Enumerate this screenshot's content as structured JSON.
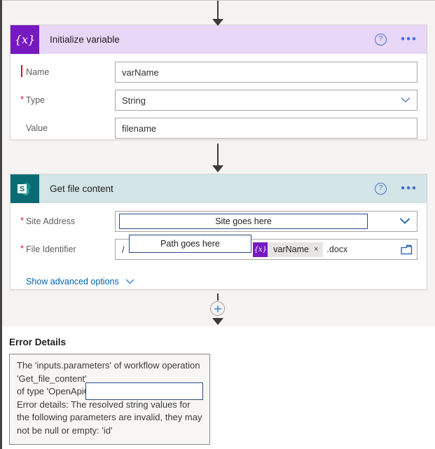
{
  "flow": {
    "cards": [
      {
        "id": "initialize-variable",
        "title": "Initialize variable",
        "icon": "variable-icon",
        "icon_glyph": "{x}",
        "header_color": "#e9d7f7",
        "icon_color": "#7719c1",
        "help_label": "?",
        "more_label": "•••",
        "fields": [
          {
            "label": "Name",
            "required": true,
            "value": "varName",
            "control": "text"
          },
          {
            "label": "Type",
            "required": true,
            "value": "String",
            "control": "dropdown"
          },
          {
            "label": "Value",
            "required": false,
            "value": "filename",
            "control": "text"
          }
        ]
      },
      {
        "id": "get-file-content",
        "title": "Get file content",
        "icon": "sharepoint-icon",
        "icon_glyph": "S",
        "header_color": "#d3e5e6",
        "icon_color": "#0a6c72",
        "help_label": "?",
        "more_label": "•••",
        "fields": [
          {
            "label": "Site Address",
            "required": true,
            "control": "dropdown",
            "annotation": "Site goes here"
          },
          {
            "label": "File Identifier",
            "required": true,
            "control": "token",
            "annotation": "Path goes here",
            "prefix_slash": "/",
            "mid_slash": "/",
            "token_glyph": "{x}",
            "token_label": "varName",
            "token_remove": "×",
            "suffix": ".docx",
            "picker_icon": "folder-icon"
          }
        ],
        "advanced_link": "Show advanced options"
      }
    ],
    "add_step_label": "+"
  },
  "error": {
    "title": "Error Details",
    "message": "The 'inputs.parameters' of workflow operation\n'Get_file_content'\nof type 'OpenApiConnection' is not valid.\nError details: The resolved string values for the following parameters are invalid, they may not be null or empty: 'id'"
  },
  "colors": {
    "canvas": "#f5f4f3",
    "variable_purple": "#7719c1",
    "sharepoint_teal": "#0a6c72",
    "link_blue": "#0063b1",
    "annotation_border": "#2a4d82",
    "required_red": "#c8102e"
  }
}
